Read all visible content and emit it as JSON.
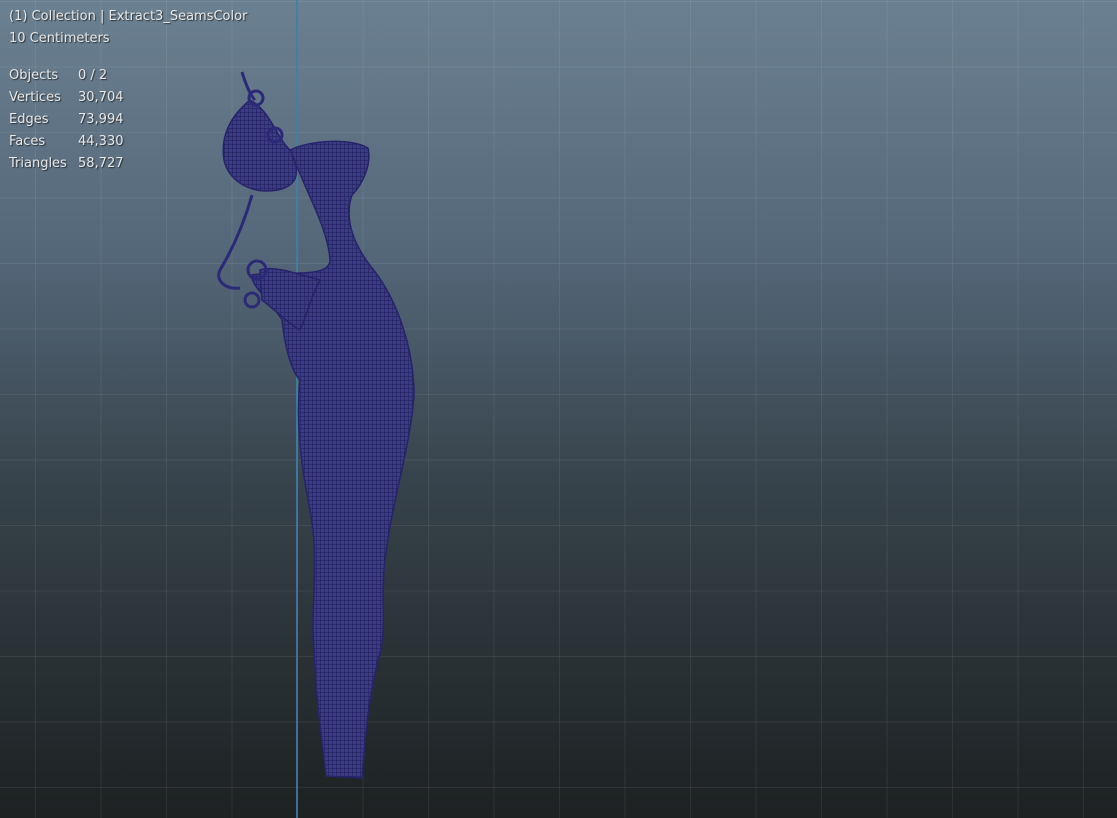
{
  "viewport": {
    "collection_label": "(1) Collection | Extract3_SeamsColor",
    "scale_label": "10 Centimeters"
  },
  "stats": [
    {
      "label": "Objects",
      "value": "0 / 2"
    },
    {
      "label": "Vertices",
      "value": "30,704"
    },
    {
      "label": "Edges",
      "value": "73,994"
    },
    {
      "label": "Faces",
      "value": "44,330"
    },
    {
      "label": "Triangles",
      "value": "58,727"
    }
  ],
  "colors": {
    "wireframe": "#2c2a78",
    "axis": "#3d7fa8"
  }
}
